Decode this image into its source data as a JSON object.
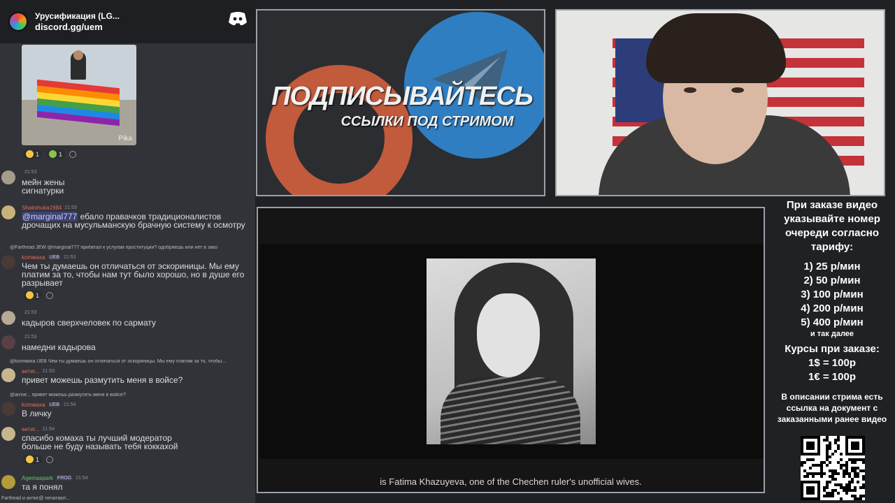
{
  "discord": {
    "server_name": "Урусификация (LG...",
    "server_link": "discord.gg/uem",
    "image_watermark": "Pika",
    "image_reactions": [
      "1",
      "1"
    ],
    "messages": [
      {
        "author": "",
        "time": "21:53",
        "text": "мейн жены сигнатурки"
      },
      {
        "author": "Shakshuka1984",
        "time": "21:53",
        "mention": "@marginal777",
        "text": " ебало правачков традиционалистов дрочащих на мусульманскую брачную систему к осмотру"
      },
      {
        "reply": "@Farthead  JEW  @marginal777  прибегал к услугам  проституции? одобряешь или нет в зако",
        "author": "komмaxa",
        "tag": "UEB",
        "time": "21:53",
        "text": "Чем ты думаешь он отличаться от эскориницы. Мы ему платим за то, чтобы нам тут было хорошо, но в душе его разрывает",
        "reaction": "1"
      },
      {
        "author": "",
        "time": "21:53",
        "text": "кадыров сверхчеловек по сармату"
      },
      {
        "author": "",
        "time": "21:53",
        "text": "намедни кадырова"
      },
      {
        "reply": "@komмaxa  UEB  Чем ты думаешь он отличаться от эскориницы. Мы ему платим за то, чтобы...",
        "author": "антиг...",
        "time": "21:53",
        "text": "привет можешь размутить меня в войсе?"
      },
      {
        "reply": "@антиг...  привет можешь размутить меня в войсе?",
        "author": "komмaxa",
        "tag": "UEB",
        "time": "21:54",
        "text": "В личку"
      },
      {
        "author": "антиг...",
        "time": "21:54",
        "text": "спасибо комаха ты лучший модератор больше не буду называть тебя коккахой",
        "reaction": "1"
      },
      {
        "author": "Agemaspark",
        "tag": "FROG",
        "time": "21:54",
        "text": "та я понял"
      }
    ],
    "typing": "Farthead и антиг@ печатают..."
  },
  "promo": {
    "title": "ПОДПИСЫВАЙТЕСЬ",
    "subtitle": "ССЫЛКИ ПОД СТРИМОМ"
  },
  "video": {
    "subtitle": "is Fatima Khazuyeva, one of the Chechen ruler's unofficial wives."
  },
  "pricing": {
    "heading": "При заказе видео указывайте номер очереди согласно тарифу:",
    "tiers": [
      "1) 25 р/мин",
      "2) 50 р/мин",
      "3) 100 р/мин",
      "4) 200 р/мин",
      "5) 400 р/мин"
    ],
    "more": "и так далее",
    "courses_title": "Курсы при заказе:",
    "rates": [
      "1$ = 100р",
      "1€ = 100р"
    ],
    "description": "В описании стрима есть ссылка на документ с заказанными ранее видео"
  },
  "colors": {
    "discord_bg": "#313338",
    "username_red": "#e36b5c",
    "telegram_blue": "#2f7ec2",
    "patreon_orange": "#c25a3c"
  }
}
